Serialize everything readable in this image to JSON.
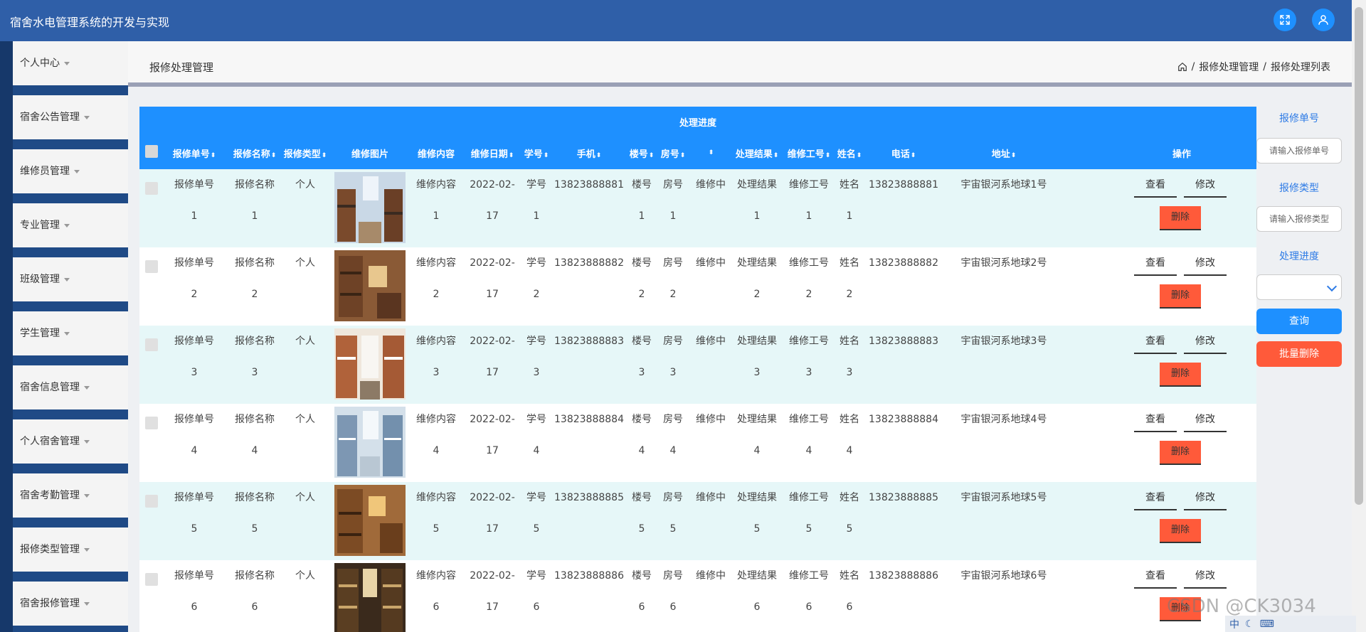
{
  "app": {
    "title": "宿舍水电管理系统的开发与实现"
  },
  "sidebar": {
    "items": [
      {
        "label": "个人中心"
      },
      {
        "label": "宿舍公告管理"
      },
      {
        "label": "维修员管理"
      },
      {
        "label": "专业管理"
      },
      {
        "label": "班级管理"
      },
      {
        "label": "学生管理"
      },
      {
        "label": "宿舍信息管理"
      },
      {
        "label": "个人宿舍管理"
      },
      {
        "label": "宿舍考勤管理"
      },
      {
        "label": "报修类型管理"
      },
      {
        "label": "宿舍报修管理"
      }
    ]
  },
  "page": {
    "title": "报修处理管理",
    "breadcrumb": [
      "报修处理管理",
      "报修处理列表"
    ],
    "breadcrumb_sep": "/"
  },
  "table": {
    "group_header": "处理进度",
    "columns": [
      "报修单号",
      "报修名称",
      "报修类型",
      "维修图片",
      "维修内容",
      "维修日期",
      "学号",
      "手机",
      "楼号",
      "房号",
      "",
      "处理结果",
      "维修工号",
      "姓名",
      "电话",
      "地址",
      "操作"
    ],
    "rows": [
      {
        "no": "报修单号1",
        "name": "报修名称",
        "name2": "1",
        "type": "个人",
        "content": "维修内容",
        "content2": "1",
        "date": "2022-02-",
        "date2": "17",
        "sid": "学号",
        "sid2": "1",
        "phone": "13823888881",
        "bldg": "楼号",
        "bldg2": "1",
        "room": "房号",
        "room2": "1",
        "status": "维修中",
        "result": "处理结果",
        "result2": "1",
        "wid": "维修工号",
        "wid2": "1",
        "pname": "姓名",
        "pname2": "1",
        "tel": "13823888881",
        "addr": "宇宙银河系地球1号"
      },
      {
        "no": "报修单号2",
        "name": "报修名称",
        "name2": "2",
        "type": "个人",
        "content": "维修内容",
        "content2": "2",
        "date": "2022-02-",
        "date2": "17",
        "sid": "学号",
        "sid2": "2",
        "phone": "13823888882",
        "bldg": "楼号",
        "bldg2": "2",
        "room": "房号",
        "room2": "2",
        "status": "维修中",
        "result": "处理结果",
        "result2": "2",
        "wid": "维修工号",
        "wid2": "2",
        "pname": "姓名",
        "pname2": "2",
        "tel": "13823888882",
        "addr": "宇宙银河系地球2号"
      },
      {
        "no": "报修单号3",
        "name": "报修名称",
        "name2": "3",
        "type": "个人",
        "content": "维修内容",
        "content2": "3",
        "date": "2022-02-",
        "date2": "17",
        "sid": "学号",
        "sid2": "3",
        "phone": "13823888883",
        "bldg": "楼号",
        "bldg2": "3",
        "room": "房号",
        "room2": "3",
        "status": "维修中",
        "result": "处理结果",
        "result2": "3",
        "wid": "维修工号",
        "wid2": "3",
        "pname": "姓名",
        "pname2": "3",
        "tel": "13823888883",
        "addr": "宇宙银河系地球3号"
      },
      {
        "no": "报修单号4",
        "name": "报修名称",
        "name2": "4",
        "type": "个人",
        "content": "维修内容",
        "content2": "4",
        "date": "2022-02-",
        "date2": "17",
        "sid": "学号",
        "sid2": "4",
        "phone": "13823888884",
        "bldg": "楼号",
        "bldg2": "4",
        "room": "房号",
        "room2": "4",
        "status": "维修中",
        "result": "处理结果",
        "result2": "4",
        "wid": "维修工号",
        "wid2": "4",
        "pname": "姓名",
        "pname2": "4",
        "tel": "13823888884",
        "addr": "宇宙银河系地球4号"
      },
      {
        "no": "报修单号5",
        "name": "报修名称",
        "name2": "5",
        "type": "个人",
        "content": "维修内容",
        "content2": "5",
        "date": "2022-02-",
        "date2": "17",
        "sid": "学号",
        "sid2": "5",
        "phone": "13823888885",
        "bldg": "楼号",
        "bldg2": "5",
        "room": "房号",
        "room2": "5",
        "status": "维修中",
        "result": "处理结果",
        "result2": "5",
        "wid": "维修工号",
        "wid2": "5",
        "pname": "姓名",
        "pname2": "5",
        "tel": "13823888885",
        "addr": "宇宙银河系地球5号"
      },
      {
        "no": "报修单号6",
        "name": "报修名称",
        "name2": "6",
        "type": "个人",
        "content": "维修内容",
        "content2": "6",
        "date": "2022-02-",
        "date2": "17",
        "sid": "学号",
        "sid2": "6",
        "phone": "13823888886",
        "bldg": "楼号",
        "bldg2": "6",
        "room": "房号",
        "room2": "6",
        "status": "维修中",
        "result": "处理结果",
        "result2": "6",
        "wid": "维修工号",
        "wid2": "6",
        "pname": "姓名",
        "pname2": "6",
        "tel": "13823888886",
        "addr": "宇宙银河系地球6号"
      }
    ],
    "actions": {
      "view": "查看",
      "edit": "修改",
      "delete": "删除"
    }
  },
  "search": {
    "no_label": "报修单号",
    "no_placeholder": "请输入报修单号",
    "type_label": "报修类型",
    "type_placeholder": "请输入报修类型",
    "progress_label": "处理进度",
    "query_button": "查询",
    "batch_delete_button": "批量删除"
  },
  "watermark": "CSDN @CK3034",
  "ime": "中",
  "colors": {
    "primary": "#1e90ff",
    "header": "#2f5fa8",
    "danger": "#ff5a3a",
    "row_alt": "#e6f7f8"
  }
}
